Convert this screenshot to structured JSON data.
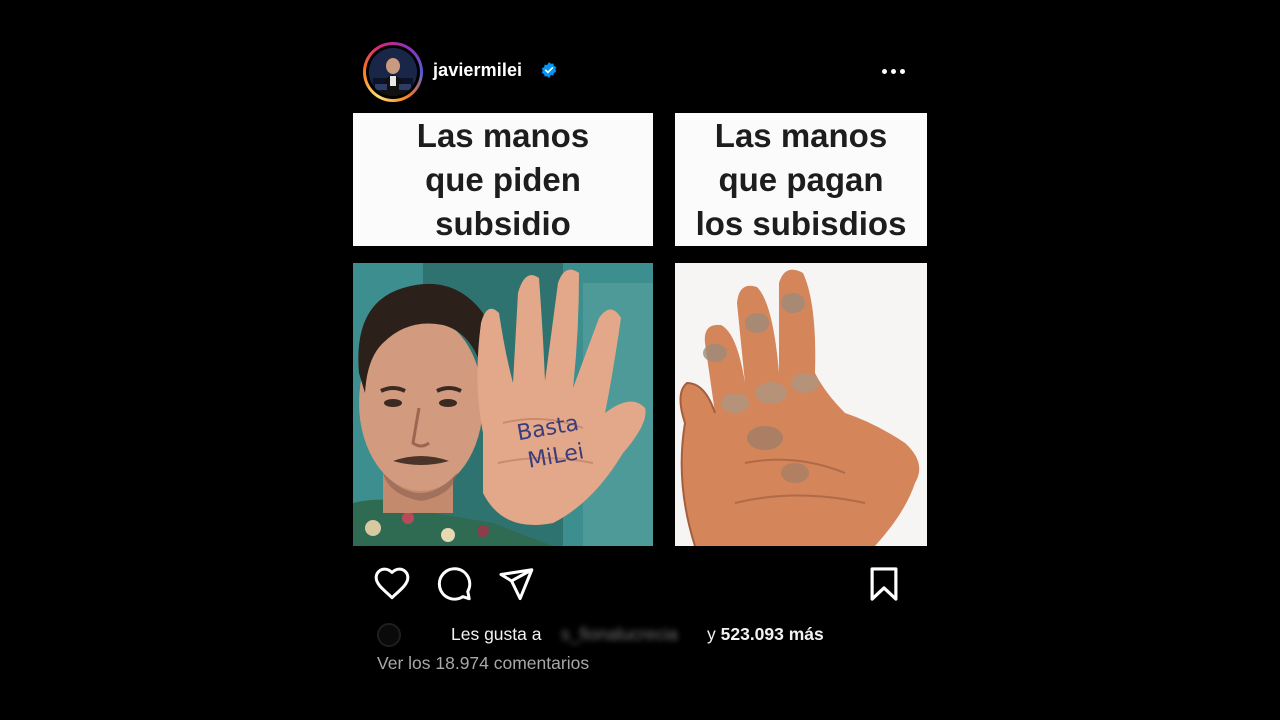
{
  "post": {
    "username": "javiermilei",
    "verified_icon": "verified-badge-icon",
    "more_icon": "more-options-icon",
    "image": {
      "caption_left": "Las manos\nque piden\nsubsidio",
      "caption_right": "Las manos\nque pagan\nlos subisdios",
      "hand_text_line1": "Basta",
      "hand_text_line2": "MiLei"
    },
    "actions": {
      "like_icon": "heart-icon",
      "comment_icon": "comment-icon",
      "share_icon": "send-icon",
      "save_icon": "bookmark-icon"
    },
    "likes": {
      "prefix": "Les gusta a",
      "liker_name": "s_fionalucrecia",
      "connector": "y",
      "count": "523.093 más"
    },
    "comments_link": "Ver los 18.974 comentarios"
  },
  "colors": {
    "background": "#000000",
    "text": "#ffffff",
    "muted_text": "#a8a8a8",
    "verified_blue": "#0095f6"
  }
}
